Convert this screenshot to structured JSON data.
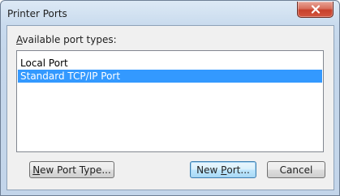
{
  "window": {
    "title": "Printer Ports",
    "close_icon": "close-icon"
  },
  "content": {
    "label_prefix": "A",
    "label_rest": "vailable port types:",
    "port_types": [
      {
        "label": "Local Port",
        "selected": false
      },
      {
        "label": "Standard TCP/IP Port",
        "selected": true
      }
    ]
  },
  "buttons": {
    "new_port_type_prefix": "N",
    "new_port_type_rest": "ew Port Type...",
    "new_port_pre": "New ",
    "new_port_key": "P",
    "new_port_post": "ort...",
    "cancel_label": "Cancel"
  },
  "colors": {
    "selection": "#3399ff",
    "close_button": "#c7402b"
  }
}
